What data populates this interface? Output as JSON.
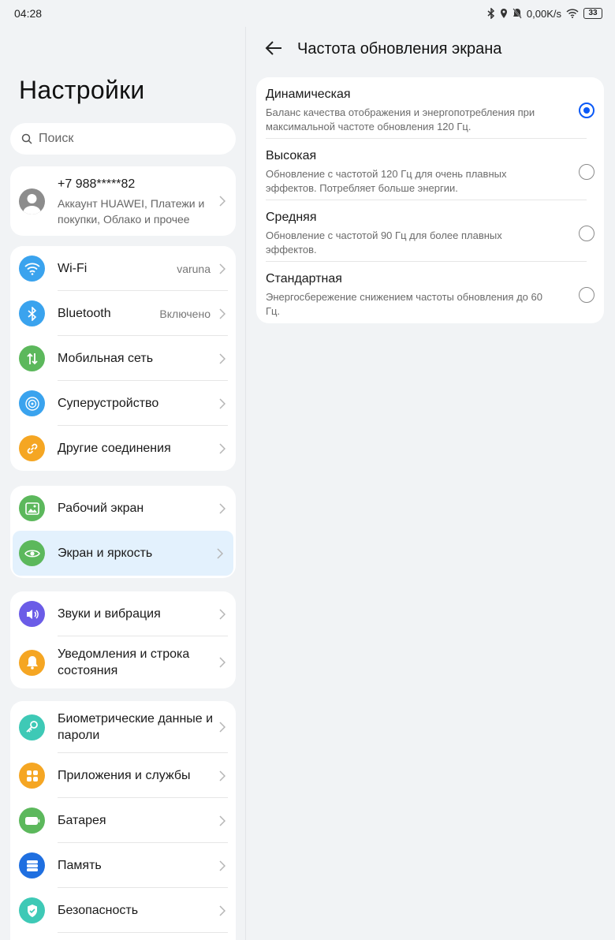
{
  "status": {
    "time": "04:28",
    "speed": "0,00K/s",
    "battery": "33"
  },
  "left": {
    "title": "Настройки",
    "search_placeholder": "Поиск",
    "account": {
      "phone": "+7 988*****82",
      "subtitle": "Аккаунт HUAWEI, Платежи и покупки, Облако и прочее"
    },
    "group1": [
      {
        "label": "Wi-Fi",
        "value": "varuna",
        "color": "#3aa3ee",
        "icon": "wifi-icon"
      },
      {
        "label": "Bluetooth",
        "value": "Включено",
        "color": "#3aa3ee",
        "icon": "bluetooth-icon"
      },
      {
        "label": "Мобильная сеть",
        "value": "",
        "color": "#5cb85c",
        "icon": "mobile-data-icon"
      },
      {
        "label": "Суперустройство",
        "value": "",
        "color": "#3aa3ee",
        "icon": "super-device-icon"
      },
      {
        "label": "Другие соединения",
        "value": "",
        "color": "#f5a623",
        "icon": "link-icon"
      }
    ],
    "group2": [
      {
        "label": "Рабочий экран",
        "color": "#5cb85c",
        "icon": "wallpaper-icon"
      },
      {
        "label": "Экран и яркость",
        "color": "#5cb85c",
        "icon": "eye-icon"
      }
    ],
    "group3": [
      {
        "label": "Звуки и вибрация",
        "color": "#6b5ce7",
        "icon": "sound-icon"
      },
      {
        "label": "Уведомления и строка состояния",
        "color": "#f5a623",
        "icon": "bell-icon"
      }
    ],
    "group4": [
      {
        "label": "Биометрические данные и пароли",
        "color": "#3ec9b6",
        "icon": "key-icon"
      },
      {
        "label": "Приложения и службы",
        "color": "#f5a623",
        "icon": "apps-icon"
      },
      {
        "label": "Батарея",
        "color": "#5cb85c",
        "icon": "battery-icon"
      },
      {
        "label": "Память",
        "color": "#1f6fe0",
        "icon": "storage-icon"
      },
      {
        "label": "Безопасность",
        "color": "#3ec9b6",
        "icon": "shield-icon"
      }
    ]
  },
  "right": {
    "title": "Частота обновления экрана",
    "options": [
      {
        "title": "Динамическая",
        "desc": "Баланс качества отображения и энергопотребления при максимальной частоте обновления 120 Гц.",
        "selected": true
      },
      {
        "title": "Высокая",
        "desc": "Обновление с частотой 120 Гц для очень плавных эффектов. Потребляет больше энергии.",
        "selected": false
      },
      {
        "title": "Средняя",
        "desc": "Обновление с частотой 90 Гц для более плавных эффектов.",
        "selected": false
      },
      {
        "title": "Стандартная",
        "desc": "Энергосбережение снижением частоты обновления до 60 Гц.",
        "selected": false
      }
    ]
  }
}
